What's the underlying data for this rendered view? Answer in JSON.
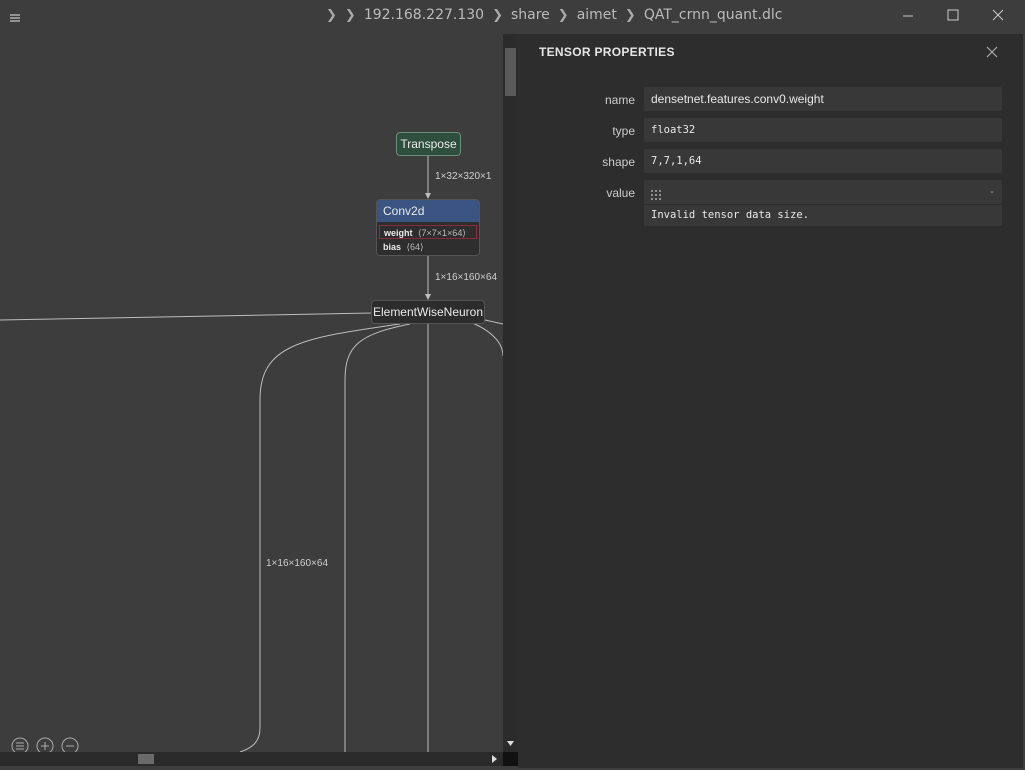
{
  "titlebar": {
    "breadcrumb": [
      "192.168.227.130",
      "share",
      "aimet",
      "QAT_crnn_quant.dlc"
    ]
  },
  "graph": {
    "nodes": {
      "transpose": "Transpose",
      "conv2d": "Conv2d",
      "conv_weight_name": "weight",
      "conv_weight_shape": "⟨7×7×1×64⟩",
      "conv_bias_name": "bias",
      "conv_bias_shape": "⟨64⟩",
      "elementwise": "ElementWiseNeuron"
    },
    "edges": {
      "transpose_to_conv": "1×32×320×1",
      "conv_to_elementwise": "1×16×160×64",
      "elementwise_branch": "1×16×160×64"
    }
  },
  "panel": {
    "title": "TENSOR PROPERTIES",
    "name_label": "name",
    "name_value": "densetnet.features.conv0.weight",
    "type_label": "type",
    "type_value": "float32",
    "shape_label": "shape",
    "shape_value": "7,7,1,64",
    "value_label": "value",
    "value_dash": "-",
    "value_message": "Invalid tensor data size."
  },
  "colors": {
    "background": "#3d3d3d",
    "panel": "#2d2d2d",
    "transpose_node": "#2f4f3e",
    "conv_header": "#3b5482",
    "selected_border": "#8a2a35"
  }
}
